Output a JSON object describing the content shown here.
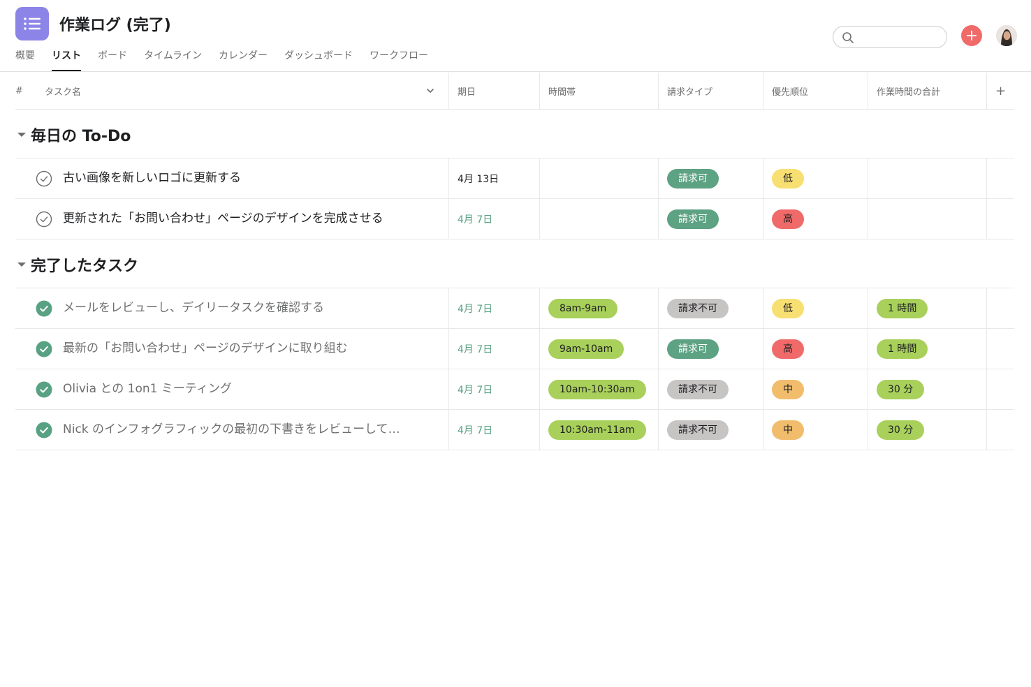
{
  "project": {
    "title": "作業ログ (完了)"
  },
  "tabs": [
    "概要",
    "リスト",
    "ボード",
    "タイムライン",
    "カレンダー",
    "ダッシュボード",
    "ワークフロー"
  ],
  "active_tab": "リスト",
  "search": {
    "value": "",
    "placeholder": ""
  },
  "columns": {
    "number": "#",
    "task": "タスク名",
    "due": "期日",
    "time_slot": "時間帯",
    "billing": "請求タイプ",
    "priority": "優先順位",
    "total_hours": "作業時間の合計",
    "add": "+"
  },
  "sections": [
    {
      "title": "毎日の To-Do",
      "tasks": [
        {
          "name": "古い画像を新しいロゴに更新する",
          "completed": false,
          "due": "4月 13日",
          "due_color": "default",
          "time_slot": "",
          "billing": "請求可",
          "billing_kind": "billable",
          "priority": "低",
          "priority_kind": "low",
          "total_hours": ""
        },
        {
          "name": "更新された「お問い合わせ」ページのデザインを完成させる",
          "completed": false,
          "due": "4月 7日",
          "due_color": "green",
          "time_slot": "",
          "billing": "請求可",
          "billing_kind": "billable",
          "priority": "高",
          "priority_kind": "high",
          "total_hours": ""
        }
      ]
    },
    {
      "title": "完了したタスク",
      "tasks": [
        {
          "name": "メールをレビューし、デイリータスクを確認する",
          "completed": true,
          "due": "4月 7日",
          "due_color": "green",
          "time_slot": "8am-9am",
          "billing": "請求不可",
          "billing_kind": "nonbillable",
          "priority": "低",
          "priority_kind": "low",
          "total_hours": "1 時間"
        },
        {
          "name": "最新の「お問い合わせ」ページのデザインに取り組む",
          "completed": true,
          "due": "4月 7日",
          "due_color": "green",
          "time_slot": "9am-10am",
          "billing": "請求可",
          "billing_kind": "billable",
          "priority": "高",
          "priority_kind": "high",
          "total_hours": "1 時間"
        },
        {
          "name": "Olivia との 1on1 ミーティング",
          "completed": true,
          "due": "4月 7日",
          "due_color": "green",
          "time_slot": "10am-10:30am",
          "billing": "請求不可",
          "billing_kind": "nonbillable",
          "priority": "中",
          "priority_kind": "mid",
          "total_hours": "30 分"
        },
        {
          "name": "Nick のインフォグラフィックの最初の下書きをレビューして…",
          "completed": true,
          "due": "4月 7日",
          "due_color": "green",
          "time_slot": "10:30am-11am",
          "billing": "請求不可",
          "billing_kind": "nonbillable",
          "priority": "中",
          "priority_kind": "mid",
          "total_hours": "30 分"
        }
      ]
    }
  ],
  "colors": {
    "app_icon": "#8d84e8",
    "add_button": "#f06a6a",
    "billable": "#5da283",
    "nonbillable": "#c7c4c4",
    "time_slot": "#a8d05a",
    "priority_low": "#f8df72",
    "priority_high": "#f06a6a",
    "priority_mid": "#f1bd6c",
    "check_done": "#58a182"
  },
  "icons": {
    "app": "list-icon",
    "search": "search-icon",
    "add": "plus-icon",
    "sort": "chevron-down-icon",
    "section_toggle": "caret-down-icon",
    "task_open": "check-circle-outline-icon",
    "task_done": "check-circle-filled-icon"
  }
}
